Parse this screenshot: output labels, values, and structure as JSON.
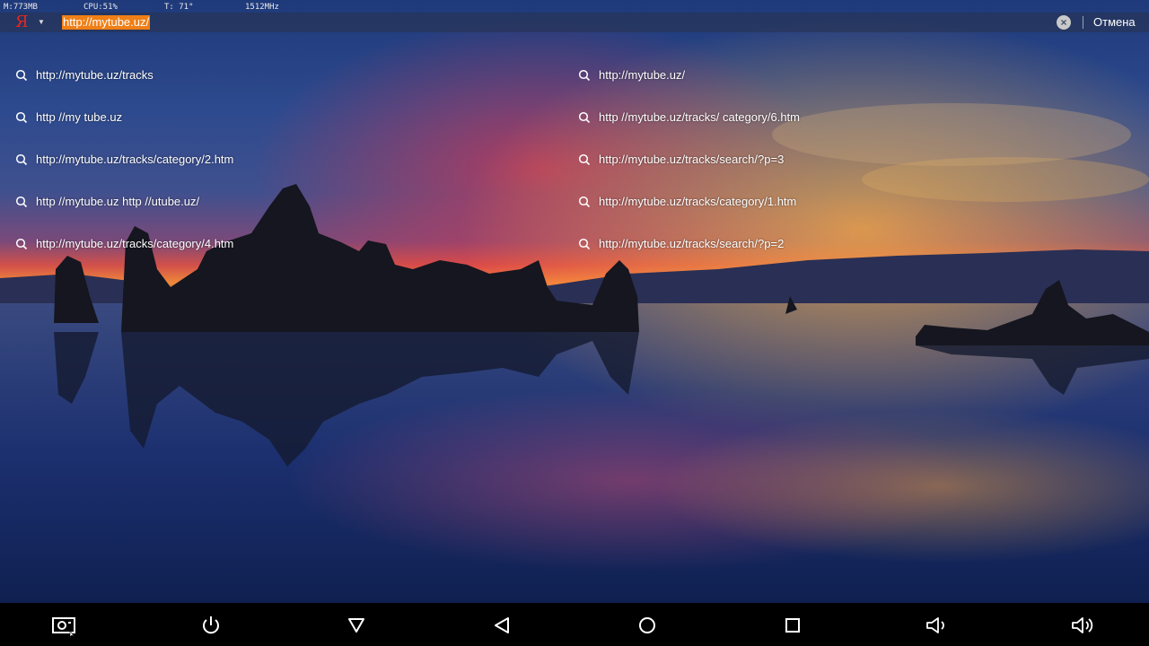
{
  "status": {
    "memory": "M:773MB",
    "cpu": "CPU:51%",
    "temp": "T: 71°",
    "freq": "1512MHz"
  },
  "searchbar": {
    "logo": "Я",
    "url": "http://mytube.uz/",
    "cancel_label": "Отмена",
    "highlight_color": "#f07f16"
  },
  "suggestions": {
    "left": [
      "http://mytube.uz/tracks",
      "http //my tube.uz",
      "http://mytube.uz/tracks/category/2.htm",
      "http //mytube.uz http //utube.uz/",
      "http://mytube.uz/tracks/category/4.htm"
    ],
    "right": [
      "http://mytube.uz/",
      "http //mytube.uz/tracks/ category/6.htm",
      "http://mytube.uz/tracks/search/?p=3",
      "http://mytube.uz/tracks/category/1.htm",
      "http://mytube.uz/tracks/search/?p=2"
    ]
  },
  "navbar": {
    "icons": [
      "screenshot-icon",
      "power-icon",
      "menu-down-icon",
      "back-icon",
      "home-icon",
      "recents-icon",
      "volume-down-icon",
      "volume-up-icon"
    ]
  }
}
